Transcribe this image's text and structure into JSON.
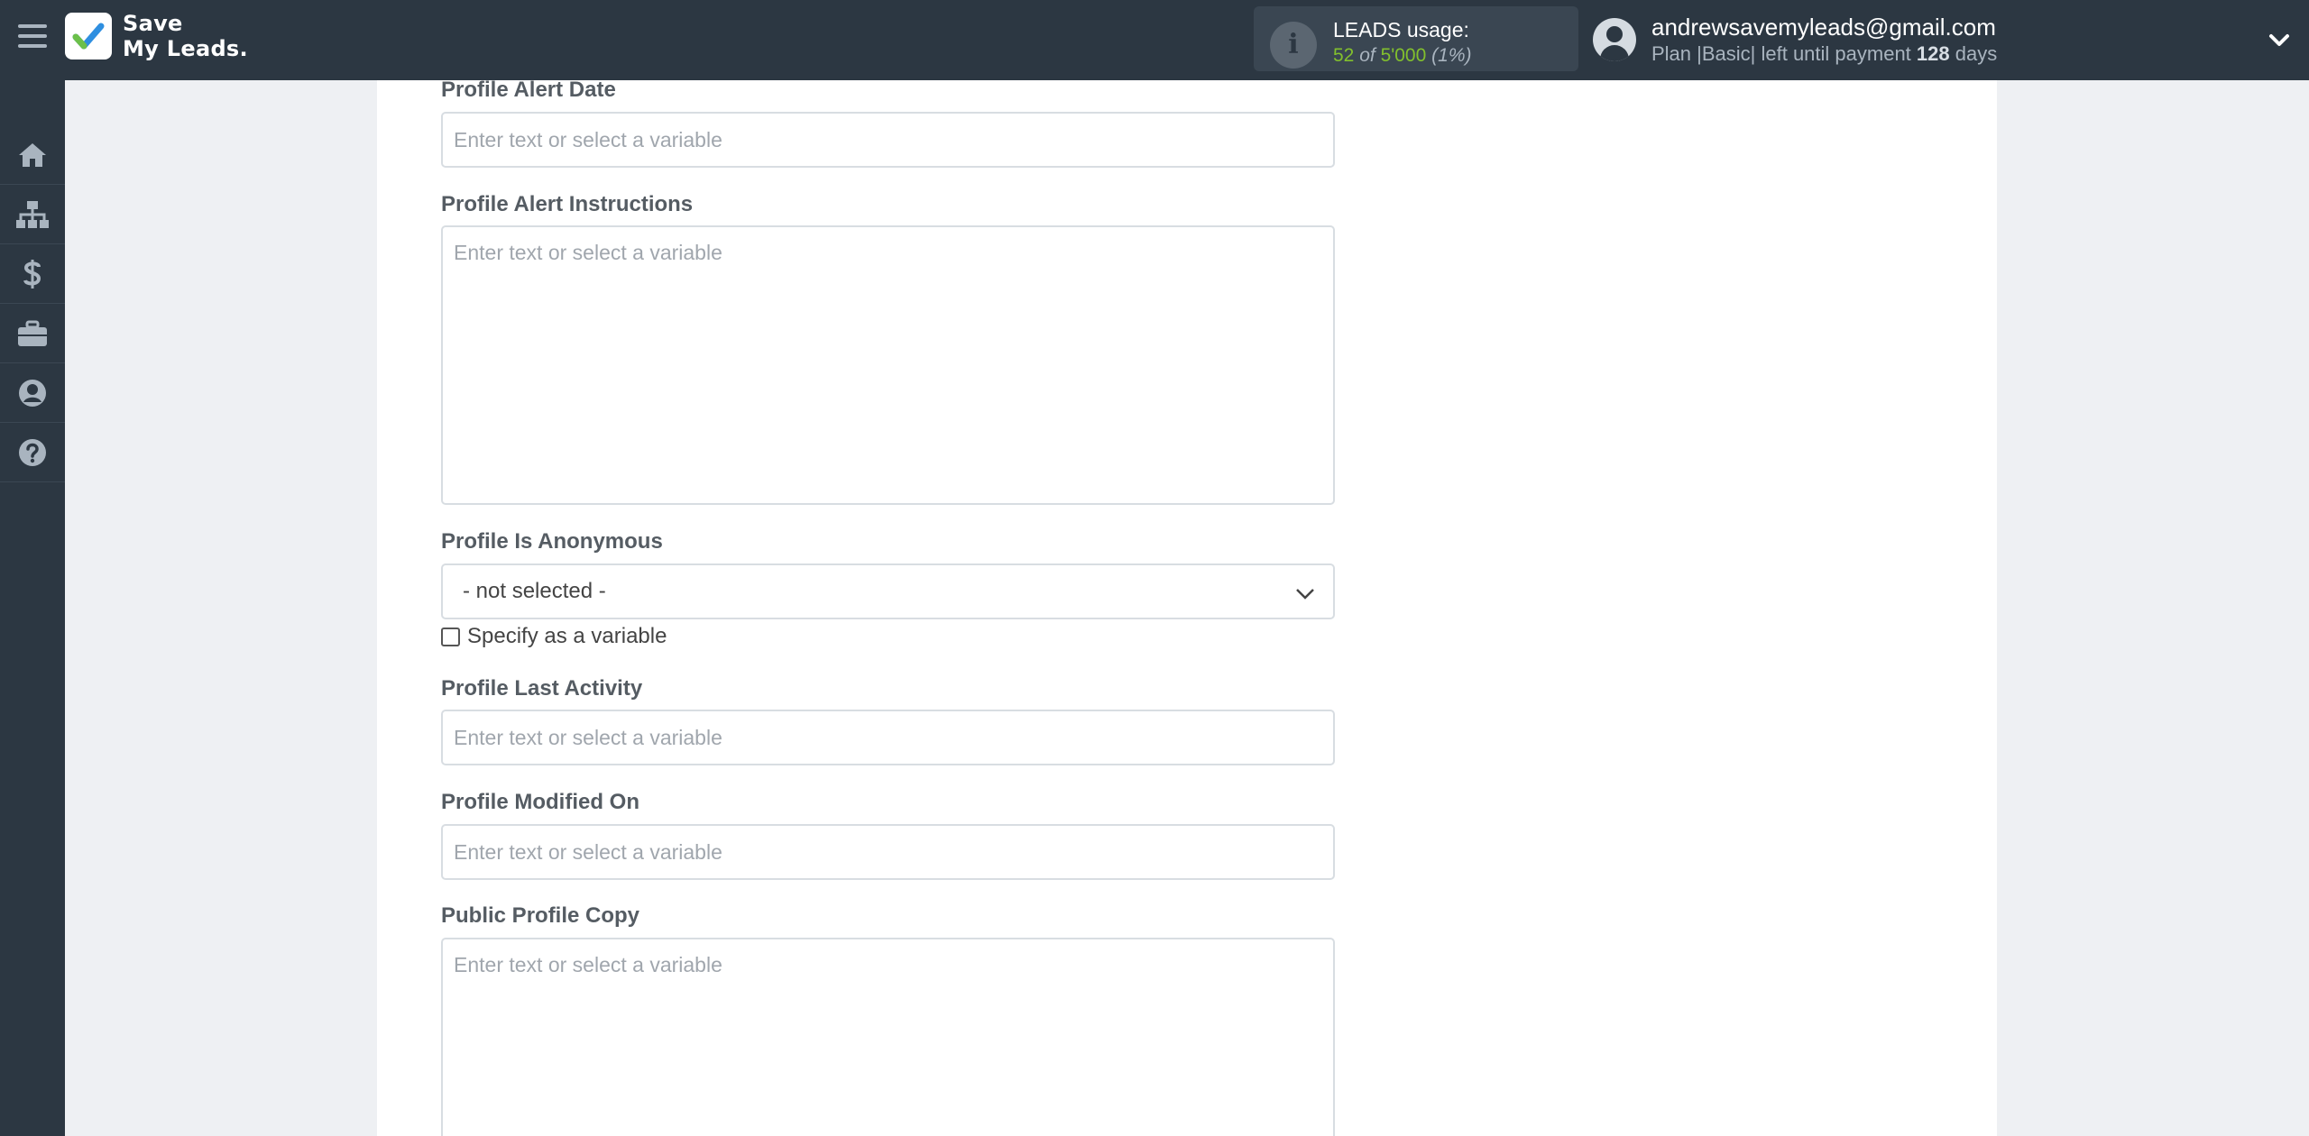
{
  "app": {
    "logo_line1": "Save",
    "logo_line2": "My Leads."
  },
  "usage": {
    "title": "LEADS usage:",
    "used": "52",
    "of_label": "of",
    "limit": "5'000",
    "percent": "(1%)"
  },
  "user": {
    "email": "andrewsavemyleads@gmail.com",
    "plan_prefix": "Plan |Basic| left until payment ",
    "days": "128",
    "days_suffix": " days"
  },
  "sidebar": {
    "items": [
      {
        "icon": "home-icon"
      },
      {
        "icon": "sitemap-icon"
      },
      {
        "icon": "dollar-icon"
      },
      {
        "icon": "briefcase-icon"
      },
      {
        "icon": "user-circle-icon"
      },
      {
        "icon": "question-circle-icon"
      }
    ]
  },
  "form": {
    "fields": {
      "profile_alert_date": {
        "label": "Profile Alert Date",
        "placeholder": "Enter text or select a variable"
      },
      "profile_alert_instructions": {
        "label": "Profile Alert Instructions",
        "placeholder": "Enter text or select a variable"
      },
      "profile_is_anonymous": {
        "label": "Profile Is Anonymous",
        "value": "- not selected -",
        "checkbox_label": "Specify as a variable"
      },
      "profile_last_activity": {
        "label": "Profile Last Activity",
        "placeholder": "Enter text or select a variable"
      },
      "profile_modified_on": {
        "label": "Profile Modified On",
        "placeholder": "Enter text or select a variable"
      },
      "public_profile_copy": {
        "label": "Public Profile Copy",
        "placeholder": "Enter text or select a variable"
      }
    }
  },
  "colors": {
    "topbar": "#2c3742",
    "accent_green": "#82c02d",
    "logo_check_blue": "#2f8fe0",
    "logo_check_green": "#6cc04a"
  }
}
